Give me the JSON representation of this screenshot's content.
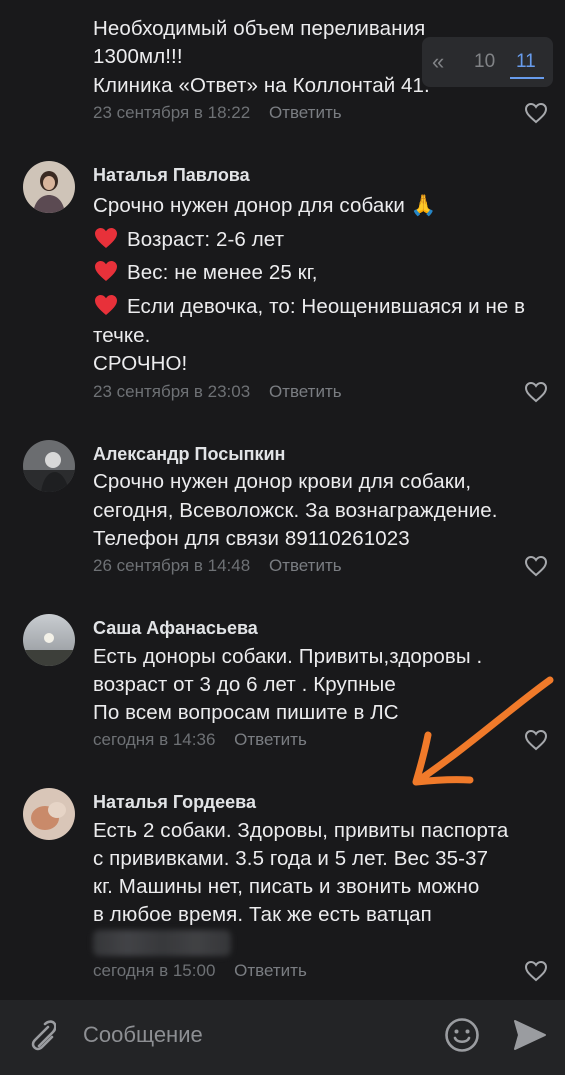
{
  "pager": {
    "prev": "«",
    "page_10": "10",
    "page_11": "11"
  },
  "comments": [
    {
      "name": "",
      "lines": [
        "Необходимый объем переливания",
        "1300мл!!!",
        "Клиника «Ответ» на Коллонтай 41."
      ],
      "time": "23 сентября в 18:22",
      "reply": "Ответить"
    },
    {
      "name": "Наталья Павлова",
      "lines": [
        "Срочно нужен донор для собаки 🙏",
        "Возраст: 2-6 лет",
        "Вес: не менее 25 кг,",
        "Если девочка, то: Неощенившаяся и не в",
        "течке.",
        "СРОЧНО!"
      ],
      "time": "23 сентября в 23:03",
      "reply": "Ответить"
    },
    {
      "name": "Александр Посыпкин",
      "lines": [
        "Срочно нужен донор крови для собаки,",
        "сегодня, Всеволожск. За вознаграждение.",
        "Телефон для связи 89110261023"
      ],
      "time": "26 сентября в 14:48",
      "reply": "Ответить"
    },
    {
      "name": "Саша Афанасьева",
      "lines": [
        "Есть доноры собаки. Привиты,здоровы .",
        "возраст от 3 до 6 лет . Крупные",
        "По всем вопросам пишите в ЛС"
      ],
      "time": "сегодня в 14:36",
      "reply": "Ответить"
    },
    {
      "name": "Наталья Гордеева",
      "lines": [
        "Есть 2 собаки. Здоровы, привиты паспорта",
        "с прививками. 3.5 года и 5 лет. Вес 35-37",
        "кг. Машины нет, писать и звонить можно",
        "в любое время. Так же есть ватцап"
      ],
      "time": "сегодня в 15:00",
      "reply": "Ответить"
    }
  ],
  "composer": {
    "placeholder": "Сообщение"
  },
  "icons": {
    "like": "heart-outline-icon",
    "attach": "paperclip-icon",
    "emoji": "smile-icon",
    "send": "send-arrow-icon",
    "heart_emoji": "red-heart-icon"
  },
  "colors": {
    "accent": "#6fa8ff",
    "arrow": "#f07a2a",
    "heart": "#e8313a"
  }
}
